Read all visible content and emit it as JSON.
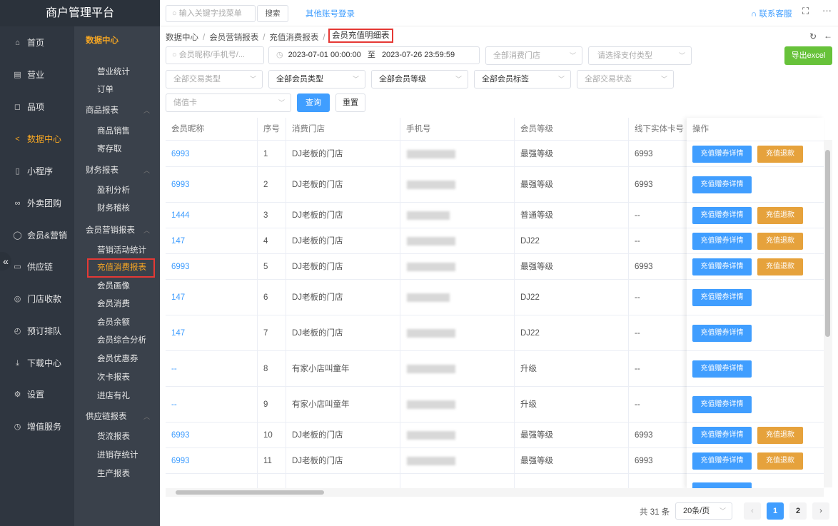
{
  "app": {
    "title": "商户管理平台"
  },
  "topbar": {
    "search_placeholder": "输入关键字找菜单",
    "search_button": "搜索",
    "other_login": "其他账号登录",
    "contact": "联系客服",
    "fullscreen_icon": "fullscreen-icon",
    "more_icon": "more-icon"
  },
  "nav_main": [
    {
      "label": "首页",
      "icon": "home-icon"
    },
    {
      "label": "营业",
      "icon": "calendar-icon"
    },
    {
      "label": "品项",
      "icon": "bag-icon"
    },
    {
      "label": "数据中心",
      "icon": "share-icon",
      "active": true
    },
    {
      "label": "小程序",
      "icon": "phone-icon"
    },
    {
      "label": "外卖团购",
      "icon": "group-icon"
    },
    {
      "label": "会员&营销",
      "icon": "user-icon"
    },
    {
      "label": "供应链",
      "icon": "truck-icon"
    },
    {
      "label": "门店收款",
      "icon": "coin-icon"
    },
    {
      "label": "预订排队",
      "icon": "clock-icon"
    },
    {
      "label": "下载中心",
      "icon": "download-icon"
    },
    {
      "label": "设置",
      "icon": "gear-icon"
    },
    {
      "label": "增值服务",
      "icon": "alarm-icon"
    }
  ],
  "nav_sub": {
    "header": "数据中心",
    "groups": [
      "商品报表",
      "财务报表",
      "会员营销报表",
      "供应链报表"
    ],
    "items": [
      "营业统计",
      "订单",
      "商品销售",
      "寄存取",
      "盈利分析",
      "财务稽核",
      "营销活动统计",
      "充值消费报表",
      "会员画像",
      "会员消费",
      "会员余额",
      "会员综合分析",
      "会员优惠券",
      "次卡报表",
      "进店有礼",
      "货流报表",
      "进销存统计",
      "生产报表"
    ]
  },
  "breadcrumb": [
    "数据中心",
    "会员营销报表",
    "充值消费报表",
    "会员充值明细表"
  ],
  "filters": {
    "member_placeholder": "会员昵称/手机号/...",
    "date_start": "2023-07-01 00:00:00",
    "date_sep": "至",
    "date_end": "2023-07-26 23:59:59",
    "store": "全部消费门店",
    "pay_type": "请选择支付类型",
    "export": "导出excel",
    "trade_type": "全部交易类型",
    "member_type": "全部会员类型",
    "member_level": "全部会员等级",
    "member_tag": "全部会员标签",
    "trade_status": "全部交易状态",
    "card_type": "储值卡",
    "query": "查询",
    "reset": "重置"
  },
  "table": {
    "headers": [
      "会员昵称",
      "序号",
      "消费门店",
      "手机号",
      "会员等级",
      "线下实体卡号",
      "操作"
    ],
    "detail_btn": "充值赠券详情",
    "refund_btn": "充值退款",
    "rows": [
      {
        "nick": "6993",
        "no": "1",
        "store": "DJ老板的门店",
        "level": "最强等级",
        "card": "6993",
        "refund": true
      },
      {
        "nick": "6993",
        "no": "2",
        "store": "DJ老板的门店",
        "level": "最强等级",
        "card": "6993",
        "refund": false
      },
      {
        "nick": "1444",
        "no": "3",
        "store": "DJ老板的门店",
        "level": "普通等级",
        "card": "--",
        "refund": true
      },
      {
        "nick": "147",
        "no": "4",
        "store": "DJ老板的门店",
        "level": "DJ22",
        "card": "--",
        "refund": true
      },
      {
        "nick": "6993",
        "no": "5",
        "store": "DJ老板的门店",
        "level": "最强等级",
        "card": "6993",
        "refund": true
      },
      {
        "nick": "147",
        "no": "6",
        "store": "DJ老板的门店",
        "level": "DJ22",
        "card": "--",
        "refund": false
      },
      {
        "nick": "147",
        "no": "7",
        "store": "DJ老板的门店",
        "level": "DJ22",
        "card": "--",
        "refund": false
      },
      {
        "nick": "--",
        "no": "8",
        "store": "有家小店叫童年",
        "level": "升级",
        "card": "--",
        "refund": false
      },
      {
        "nick": "--",
        "no": "9",
        "store": "有家小店叫童年",
        "level": "升级",
        "card": "--",
        "refund": false
      },
      {
        "nick": "6993",
        "no": "10",
        "store": "DJ老板的门店",
        "level": "最强等级",
        "card": "6993",
        "refund": true
      },
      {
        "nick": "6993",
        "no": "11",
        "store": "DJ老板的门店",
        "level": "最强等级",
        "card": "6993",
        "refund": true
      }
    ]
  },
  "pagination": {
    "total": "共 31 条",
    "page_size": "20条/页",
    "pages": [
      "1",
      "2"
    ],
    "current": "1"
  }
}
